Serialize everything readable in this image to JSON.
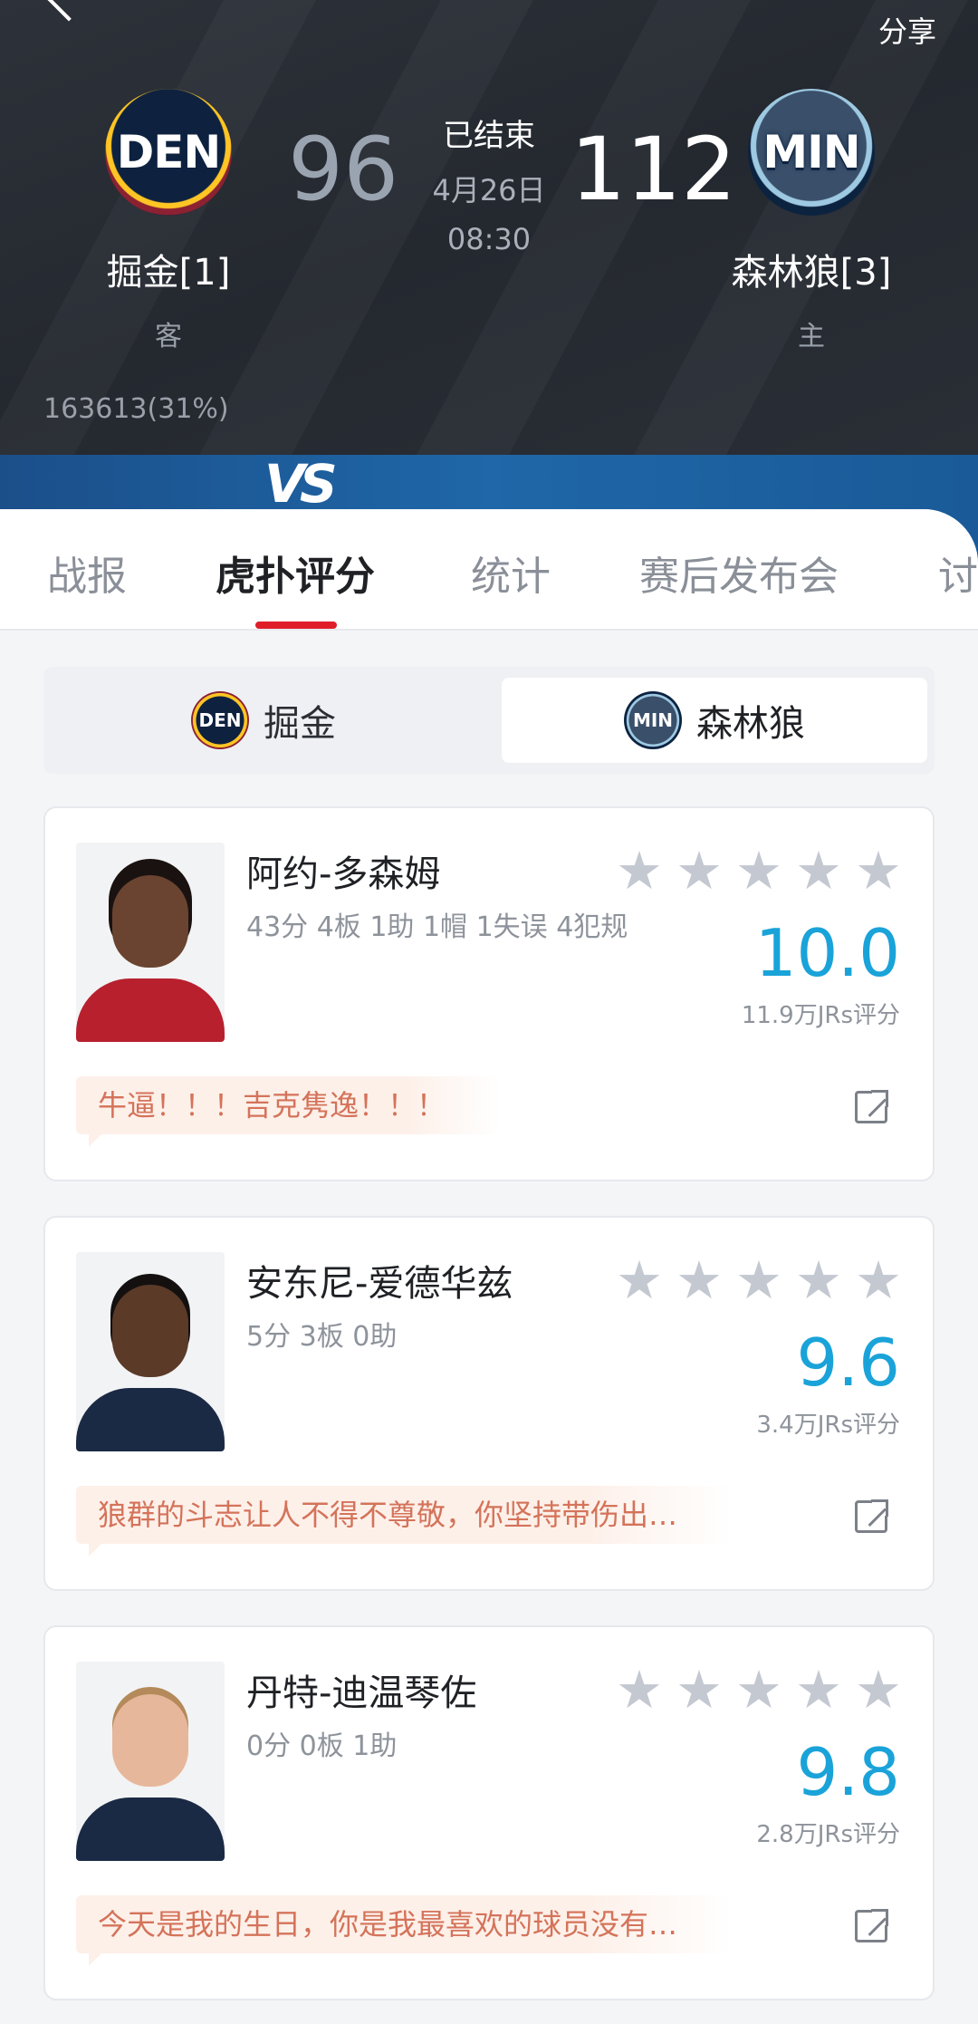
{
  "header": {
    "share_label": "分享",
    "away_team": {
      "abbr": "DEN",
      "name": "掘金[1]",
      "side": "客",
      "score": "96"
    },
    "home_team": {
      "abbr": "MIN",
      "name": "森林狼[3]",
      "side": "主",
      "score": "112"
    },
    "status": "已结束",
    "date": "4月26日",
    "time": "08:30",
    "vote_count": "163613(31%)",
    "vs_mark": "VS"
  },
  "tabs": [
    {
      "label": "战报",
      "active": false
    },
    {
      "label": "虎扑评分",
      "active": true
    },
    {
      "label": "统计",
      "active": false
    },
    {
      "label": "赛后发布会",
      "active": false
    },
    {
      "label": "讨",
      "active": false
    }
  ],
  "team_switch": {
    "left": {
      "abbr": "DEN",
      "label": "掘金"
    },
    "right": {
      "abbr": "MIN",
      "label": "森林狼",
      "selected": true
    }
  },
  "players": [
    {
      "name": "阿约-多森姆",
      "stats": "43分 4板 1助 1帽 1失误 4犯规",
      "rating": "10.0",
      "rating_count": "11.9万JRs评分",
      "stars": 5,
      "comment": "牛逼！！！吉克隽逸！！！"
    },
    {
      "name": "安东尼-爱德华兹",
      "stats": "5分 3板 0助",
      "rating": "9.6",
      "rating_count": "3.4万JRs评分",
      "stars": 5,
      "comment": "狼群的斗志让人不得不尊敬，你坚持带伤出…"
    },
    {
      "name": "丹特-迪温琴佐",
      "stats": "0分 0板 1助",
      "rating": "9.8",
      "rating_count": "2.8万JRs评分",
      "stars": 5,
      "comment": "今天是我的生日，你是我最喜欢的球员没有…"
    }
  ],
  "colors": {
    "accent_blue": "#1aa3d9",
    "tab_underline": "#e01e2a",
    "comment_text": "#d4735a"
  }
}
